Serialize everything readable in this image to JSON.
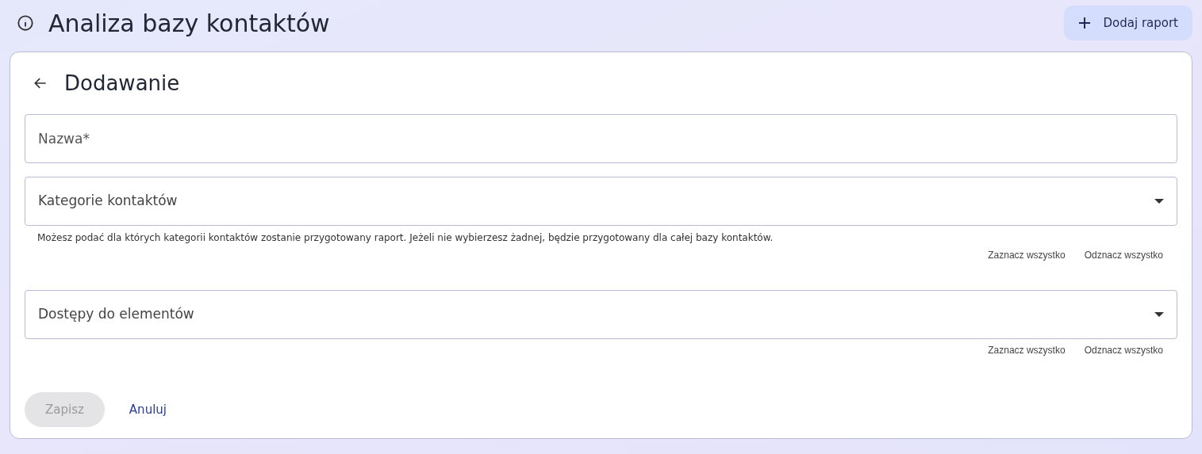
{
  "header": {
    "title": "Analiza bazy kontaktów",
    "add_button": "Dodaj raport"
  },
  "form": {
    "title": "Dodawanie",
    "fields": [
      {
        "kind": "text",
        "placeholder": "Nazwa*"
      },
      {
        "kind": "select",
        "label": "Kategorie kontaktów",
        "helper": "Możesz podać dla których kategorii kontaktów zostanie przygotowany raport. Jeżeli nie wybierzesz żadnej, będzie przygotowany dla całej bazy kontaktów.",
        "actions": [
          "Zaznacz wszystko",
          "Odznacz wszystko"
        ]
      },
      {
        "kind": "select",
        "label": "Dostępy do elementów",
        "actions": [
          "Zaznacz wszystko",
          "Odznacz wszystko"
        ]
      }
    ],
    "buttons": [
      {
        "kind": "primary",
        "label": "Zapisz",
        "disabled": true
      },
      {
        "kind": "link",
        "label": "Anuluj",
        "disabled": false
      }
    ]
  }
}
